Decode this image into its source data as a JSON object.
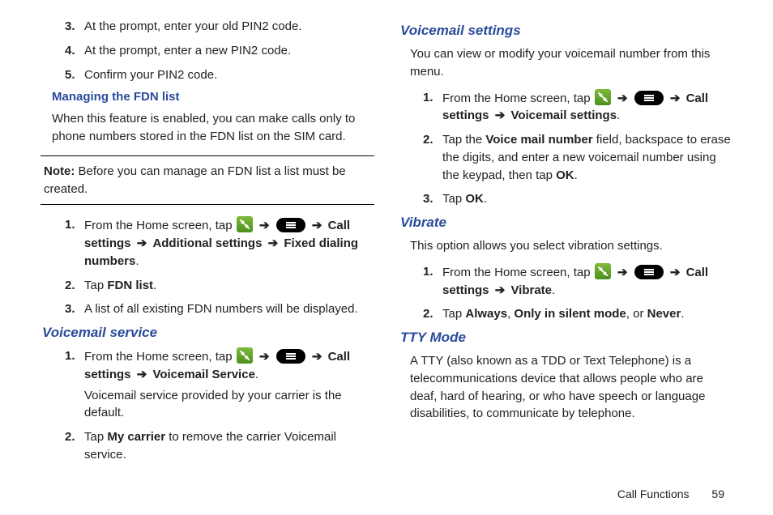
{
  "left": {
    "step3": "At the prompt, enter your old PIN2 code.",
    "step4": "At the prompt, enter a new PIN2 code.",
    "step5": "Confirm your PIN2 code.",
    "h_managing": "Managing the FDN list",
    "p_managing": "When this feature is enabled, you can make calls only to phone numbers stored in the FDN list on the SIM card.",
    "note_label": "Note:",
    "note_body": " Before you can manage an FDN list a list must be created.",
    "fdn1_a": "From the Home screen, tap ",
    "fdn1_b": " Call settings ",
    "fdn1_c": " Additional settings ",
    "fdn1_d": " Fixed dialing numbers",
    "fdn2_a": "Tap ",
    "fdn2_b": "FDN list",
    "fdn3": "A list of all existing FDN numbers will be displayed.",
    "h_vms": "Voicemail service",
    "vms1_a": "From the Home screen, tap ",
    "vms1_b": " Call settings ",
    "vms1_c": " Voicemail Service",
    "vms1_sub": "Voicemail service provided by your carrier is the default.",
    "vms2_a": "Tap ",
    "vms2_b": "My carrier",
    "vms2_c": " to remove the carrier Voicemail service."
  },
  "right": {
    "h_vmset": "Voicemail settings",
    "p_vmset": "You can view or modify your voicemail number from this menu.",
    "vmset1_a": "From the Home screen, tap ",
    "vmset1_b": " Call settings ",
    "vmset1_c": " Voicemail settings",
    "vmset2_a": "Tap the ",
    "vmset2_b": "Voice mail number",
    "vmset2_c": " field, backspace to erase the digits, and enter a new voicemail number using the keypad, then tap ",
    "vmset2_d": "OK",
    "vmset3_a": "Tap ",
    "vmset3_b": "OK",
    "h_vib": "Vibrate",
    "p_vib": "This option allows you select vibration settings.",
    "vib1_a": "From the Home screen, tap ",
    "vib1_b": " Call settings ",
    "vib1_c": " Vibrate",
    "vib2_a": "Tap ",
    "vib2_b": "Always",
    "vib2_c": ", ",
    "vib2_d": "Only in silent mode",
    "vib2_e": ", or ",
    "vib2_f": "Never",
    "h_tty": "TTY Mode",
    "p_tty": "A TTY (also known as a TDD or Text Telephone) is a telecommunications device that allows people who are deaf, hard of hearing, or who have speech or language disabilities, to communicate by telephone."
  },
  "arrow": "➔",
  "footer": {
    "section": "Call Functions",
    "page": "59"
  },
  "nums": {
    "n1": "1.",
    "n2": "2.",
    "n3": "3.",
    "n4": "4.",
    "n5": "5."
  }
}
